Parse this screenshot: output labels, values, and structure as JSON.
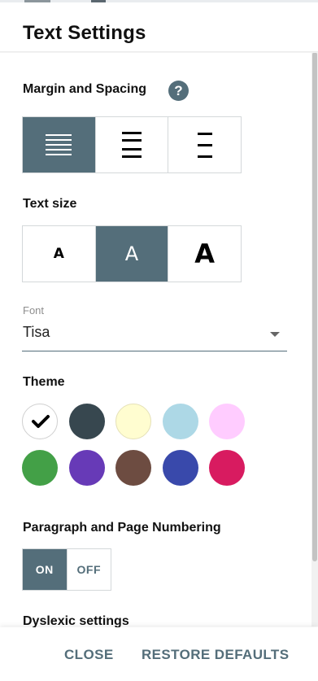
{
  "panel": {
    "title": "Text Settings"
  },
  "margin": {
    "label": "Margin and Spacing",
    "help_icon": "?",
    "options": [
      "wide-margin",
      "medium-margin",
      "narrow-margin"
    ],
    "selected_index": 0
  },
  "text_size": {
    "label": "Text size",
    "options": [
      "A",
      "A",
      "A"
    ],
    "selected_index": 1
  },
  "font": {
    "caption": "Font",
    "value": "Tisa"
  },
  "theme": {
    "label": "Theme",
    "selected_index": 0,
    "colors": [
      "#ffffff",
      "#37474f",
      "#fffdd0",
      "#add8e6",
      "#ffccff",
      "#43a047",
      "#673ab7",
      "#6d4c41",
      "#3949ab",
      "#d81b60"
    ]
  },
  "numbering": {
    "label": "Paragraph and Page Numbering",
    "on_label": "ON",
    "off_label": "OFF",
    "value": "ON"
  },
  "dyslexic": {
    "label": "Dyslexic settings"
  },
  "footer": {
    "close_label": "CLOSE",
    "restore_label": "RESTORE DEFAULTS"
  },
  "accent_color": "#546e7a"
}
